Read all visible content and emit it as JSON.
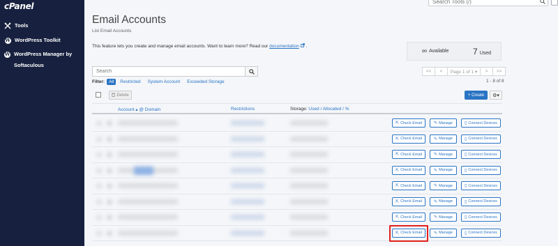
{
  "sidebar": {
    "logo": "cPanel",
    "items": [
      {
        "label": "Tools"
      },
      {
        "label": "WordPress Toolkit"
      },
      {
        "label": "WordPress Manager by Softaculous"
      }
    ]
  },
  "topbar": {
    "search_placeholder": "Search Tools (/)"
  },
  "header": {
    "title": "Email Accounts",
    "subtitle": "List Email Accounts",
    "info_text": "This feature lets you create and manage email accounts. Want to learn more? Read our",
    "info_link": "documentation",
    "info_end": "."
  },
  "stats": {
    "available_label": "Available",
    "available_symbol": "∞",
    "used_count": "7",
    "used_label": "Used"
  },
  "search": {
    "placeholder": "Search"
  },
  "pagination": {
    "first": "<<",
    "prev": "<",
    "page_label": "Page 1 of 1 ▾",
    "next": ">",
    "last": ">>",
    "count": "1 - 8 of 8"
  },
  "filter": {
    "label": "Filter:",
    "options": [
      "All",
      "Restricted",
      "System Account",
      "Exceeded Storage"
    ],
    "selected": "All"
  },
  "toolbar": {
    "delete_label": "Delete",
    "create_label": "+ Create",
    "gear_label": "⚙▾"
  },
  "table": {
    "headers": {
      "account": "Account ▴ @ Domain",
      "restrictions": "Restrictions",
      "storage_prefix": "Storage: ",
      "storage_links": "Used / Allocated / %"
    },
    "actions": {
      "check": "Check Email",
      "manage": "Manage",
      "connect": "Connect Devices"
    },
    "row_count": 8
  },
  "colors": {
    "sidebar_bg": "#17213f",
    "accent": "#2a74c4",
    "highlight": "#e0201c"
  }
}
